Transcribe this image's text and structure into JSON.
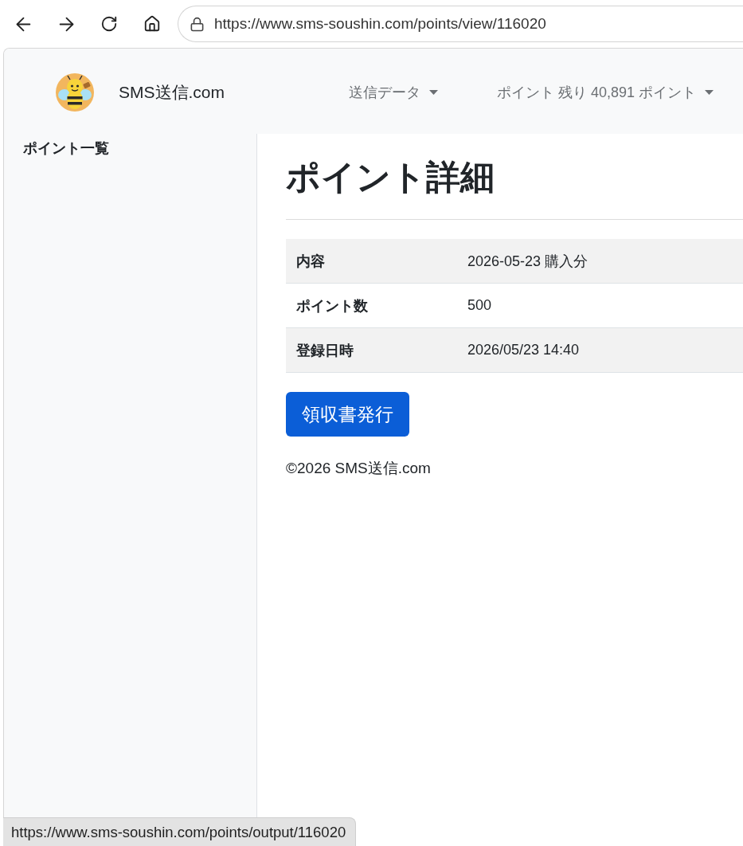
{
  "browser": {
    "url": "https://www.sms-soushin.com/points/view/116020",
    "status_url": "https://www.sms-soushin.com/points/output/116020"
  },
  "navbar": {
    "brand": "SMS送信.com",
    "menus": [
      {
        "label": "送信データ"
      },
      {
        "label": "ポイント 残り 40,891 ポイント"
      }
    ]
  },
  "sidebar": {
    "items": [
      {
        "label": "ポイント一覧"
      }
    ]
  },
  "main": {
    "title": "ポイント詳細",
    "rows": [
      {
        "label": "内容",
        "value": "2026-05-23 購入分"
      },
      {
        "label": "ポイント数",
        "value": "500"
      },
      {
        "label": "登録日時",
        "value": "2026/05/23 14:40"
      }
    ],
    "button": "領収書発行",
    "footer": "©2026 SMS送信.com"
  }
}
